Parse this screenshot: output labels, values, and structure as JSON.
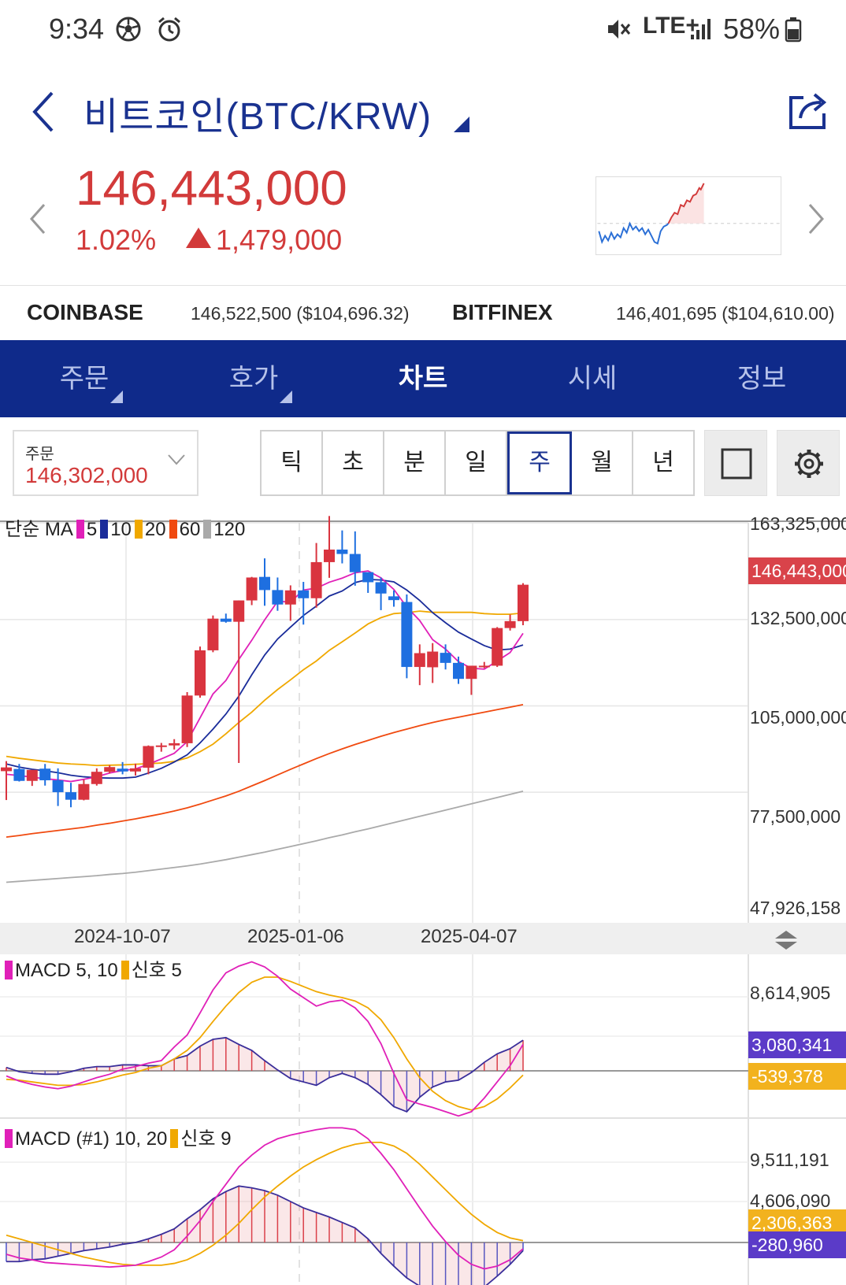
{
  "status_bar": {
    "time": "9:34",
    "network": "LTE+",
    "battery": "58%"
  },
  "header": {
    "title": "비트코인(BTC/KRW)"
  },
  "price": {
    "current": "146,443,000",
    "change_pct": "1.02%",
    "change_amount": "1,479,000"
  },
  "exchanges": [
    {
      "name": "COINBASE",
      "value": "146,522,500 ($104,696.32)"
    },
    {
      "name": "BITFINEX",
      "value": "146,401,695 ($104,610.00)"
    }
  ],
  "tabs": [
    {
      "label": "주문",
      "active": false,
      "has_caret": true
    },
    {
      "label": "호가",
      "active": false,
      "has_caret": true
    },
    {
      "label": "차트",
      "active": true,
      "has_caret": false
    },
    {
      "label": "시세",
      "active": false,
      "has_caret": false
    },
    {
      "label": "정보",
      "active": false,
      "has_caret": false
    }
  ],
  "order": {
    "label": "주문",
    "value": "146,302,000"
  },
  "periods": [
    {
      "label": "틱",
      "active": false
    },
    {
      "label": "초",
      "active": false
    },
    {
      "label": "분",
      "active": false
    },
    {
      "label": "일",
      "active": false
    },
    {
      "label": "주",
      "active": true
    },
    {
      "label": "월",
      "active": false
    },
    {
      "label": "년",
      "active": false
    }
  ],
  "colors": {
    "up": "#d9343f",
    "down": "#1e6fe0",
    "ma5": "#e020b8",
    "ma10": "#1a2c9a",
    "ma20": "#f0a800",
    "ma60": "#f04a10",
    "ma120": "#aaaaaa",
    "nav": "#0f2a8a"
  },
  "chart_data": [
    {
      "type": "candlestick",
      "legend": {
        "title": "단순 MA",
        "periods": [
          "5",
          "10",
          "20",
          "60",
          "120"
        ]
      },
      "y_ticks": [
        "163,325,000",
        "132,500,000",
        "105,000,000",
        "77,500,000",
        "47,926,158"
      ],
      "current_label": "146,443,000",
      "x_ticks": [
        "2024-10-07",
        "2025-01-06",
        "2025-04-07"
      ],
      "ylim": [
        47926158,
        163325000
      ],
      "candles": [
        [
          84.2,
          87.4,
          75.0,
          85.4
        ],
        [
          84.9,
          86.5,
          80.9,
          81.1
        ],
        [
          81.1,
          84.6,
          79.5,
          84.6
        ],
        [
          85.0,
          86.5,
          79.6,
          81.3
        ],
        [
          81.3,
          85.1,
          73.1,
          77.5
        ],
        [
          77.5,
          80.5,
          72.7,
          75.1
        ],
        [
          75.1,
          81.5,
          74.9,
          80.1
        ],
        [
          80.1,
          85.1,
          79.6,
          84.0
        ],
        [
          84.0,
          86.1,
          83.5,
          85.5
        ],
        [
          85.0,
          87.1,
          83.2,
          84.1
        ],
        [
          84.1,
          86.6,
          82.8,
          85.1
        ],
        [
          85.3,
          92.4,
          83.2,
          92.2
        ],
        [
          92.2,
          93.2,
          90.4,
          92.4
        ],
        [
          92.4,
          94.4,
          91.1,
          93.1
        ],
        [
          93.1,
          109.4,
          91.9,
          108.3
        ],
        [
          108.3,
          123.9,
          107.6,
          122.7
        ],
        [
          122.7,
          133.8,
          122.1,
          132.8
        ],
        [
          132.8,
          134.4,
          131.5,
          131.8
        ],
        [
          131.8,
          138.6,
          86.8,
          138.6
        ],
        [
          138.6,
          146.1,
          137.1,
          145.9
        ],
        [
          146.1,
          152.0,
          136.9,
          141.9
        ],
        [
          141.9,
          145.9,
          135.3,
          137.3
        ],
        [
          137.3,
          143.4,
          132.1,
          141.8
        ],
        [
          141.8,
          144.5,
          130.9,
          139.3
        ],
        [
          139.3,
          156.9,
          136.3,
          150.8
        ],
        [
          150.8,
          165.5,
          145.8,
          154.8
        ],
        [
          154.8,
          160.9,
          150.4,
          153.4
        ],
        [
          153.4,
          160.6,
          143.3,
          147.6
        ],
        [
          147.6,
          146.9,
          141.0,
          144.4
        ],
        [
          144.4,
          145.9,
          135.5,
          140.8
        ],
        [
          139.9,
          141.8,
          136.6,
          138.7
        ],
        [
          138.1,
          140.5,
          113.8,
          117.4
        ],
        [
          117.4,
          124.6,
          111.6,
          121.8
        ],
        [
          117.3,
          125.0,
          112.3,
          122.3
        ],
        [
          121.9,
          124.6,
          116.6,
          118.7
        ],
        [
          118.7,
          120.7,
          112.0,
          113.6
        ],
        [
          113.6,
          117.8,
          108.5,
          117.8
        ],
        [
          117.8,
          119.0,
          117.0,
          117.8
        ],
        [
          117.8,
          130.1,
          117.4,
          129.8
        ],
        [
          129.8,
          134.1,
          129.0,
          132.0
        ],
        [
          132.0,
          144.1,
          130.7,
          143.6
        ]
      ],
      "ma5": [
        83.2,
        82.8,
        82.3,
        81.8,
        81.4,
        80.9,
        81.6,
        82.4,
        83.6,
        84.4,
        84.9,
        86.4,
        88.1,
        89.9,
        93.6,
        101.2,
        108.8,
        113.1,
        119.8,
        125.9,
        132.4,
        138.3,
        138.1,
        141.9,
        142.5,
        144.4,
        145.7,
        147.4,
        148.0,
        145.8,
        142.1,
        136.5,
        132.2,
        126.1,
        123.1,
        119.1,
        117.0,
        116.7,
        119.3,
        122.0,
        128.1
      ],
      "ma10": [
        86.5,
        85.5,
        84.8,
        84.3,
        83.7,
        82.9,
        82.4,
        82.1,
        82.0,
        82.0,
        82.3,
        83.6,
        85.1,
        87.1,
        89.4,
        93.2,
        97.6,
        102.4,
        108.1,
        114.9,
        121.2,
        126.3,
        130.1,
        133.8,
        136.8,
        140.0,
        141.6,
        144.3,
        145.3,
        145.1,
        144.5,
        141.9,
        138.6,
        134.7,
        131.5,
        128.5,
        126.3,
        124.2,
        122.8,
        123.1,
        124.4
      ],
      "ma20": [
        88.9,
        88.3,
        87.8,
        87.3,
        86.8,
        86.5,
        86.3,
        86.0,
        86.1,
        86.2,
        86.4,
        86.6,
        86.8,
        87.3,
        88.4,
        90.4,
        92.8,
        96.1,
        99.7,
        103.0,
        106.8,
        110.2,
        113.3,
        116.5,
        119.3,
        122.7,
        125.4,
        128.2,
        131.1,
        133.1,
        134.4,
        134.7,
        135.2,
        134.8,
        134.8,
        134.8,
        134.8,
        134.4,
        134.2,
        134.2,
        134.6
      ],
      "ma60": [
        63.2,
        63.7,
        64.3,
        64.8,
        65.3,
        65.8,
        66.3,
        67.0,
        67.6,
        68.3,
        69.0,
        69.8,
        70.6,
        71.5,
        72.5,
        73.7,
        75.0,
        76.3,
        77.8,
        79.5,
        81.2,
        83.0,
        84.8,
        86.5,
        88.2,
        89.8,
        91.3,
        92.7,
        94.0,
        95.3,
        96.5,
        97.6,
        98.7,
        99.7,
        100.6,
        101.4,
        102.2,
        103.0,
        103.8,
        104.6,
        105.4
      ],
      "ma120": [
        48.8,
        49.1,
        49.4,
        49.7,
        50.0,
        50.3,
        50.6,
        50.9,
        51.3,
        51.6,
        52.0,
        52.5,
        53.0,
        53.5,
        54.0,
        54.6,
        55.3,
        56.0,
        56.8,
        57.6,
        58.4,
        59.3,
        60.2,
        61.1,
        62.0,
        63.0,
        63.9,
        64.9,
        65.8,
        66.8,
        67.8,
        68.8,
        69.8,
        70.8,
        71.8,
        72.8,
        73.8,
        74.8,
        75.8,
        76.8,
        77.8
      ],
      "units": "millions KRW"
    },
    {
      "type": "macd",
      "legend": {
        "title": "MACD 5, 10",
        "signal": "신호 5"
      },
      "y_ticks": [
        "8,614,905"
      ],
      "badges": [
        "3,080,341",
        "-539,378"
      ],
      "ylim": [
        -10500000,
        13500000
      ],
      "macd": [
        -0.6,
        -1.2,
        -1.6,
        -1.9,
        -2.1,
        -1.8,
        -1.3,
        -0.8,
        -0.4,
        0.2,
        0.5,
        0.9,
        1.2,
        2.8,
        4.2,
        6.8,
        9.5,
        11.5,
        12.3,
        12.8,
        12.2,
        11.1,
        9.6,
        8.6,
        7.6,
        8.1,
        8.3,
        7.4,
        5.8,
        3.2,
        -0.3,
        -3.4,
        -3.9,
        -4.3,
        -4.8,
        -5.3,
        -4.8,
        -3.2,
        -1.3,
        0.6,
        3.1
      ],
      "signal": [
        -1.0,
        -1.1,
        -1.3,
        -1.5,
        -1.7,
        -1.7,
        -1.6,
        -1.3,
        -0.9,
        -0.5,
        -0.2,
        0.3,
        0.6,
        1.4,
        2.4,
        3.9,
        5.8,
        7.6,
        9.2,
        10.4,
        11.0,
        11.0,
        10.5,
        9.9,
        9.3,
        8.9,
        8.6,
        8.2,
        7.4,
        6.0,
        3.9,
        1.4,
        -0.8,
        -2.4,
        -3.5,
        -4.2,
        -4.6,
        -4.2,
        -3.3,
        -2.0,
        -0.5
      ]
    },
    {
      "type": "macd",
      "legend": {
        "title": "MACD (#1) 10, 20",
        "signal": "신호 9"
      },
      "y_ticks": [
        "9,511,191",
        "4,606,090"
      ],
      "badges": [
        "2,306,363",
        "-280,960"
      ],
      "ylim": [
        -10500000,
        13500000
      ],
      "macd": [
        -1.3,
        -1.7,
        -1.9,
        -2.2,
        -2.3,
        -2.4,
        -2.5,
        -2.6,
        -2.7,
        -2.6,
        -2.5,
        -2.1,
        -1.6,
        -0.8,
        0.7,
        2.4,
        4.5,
        6.4,
        8.3,
        9.6,
        10.7,
        11.4,
        11.8,
        12.1,
        12.4,
        12.6,
        12.6,
        12.4,
        11.4,
        9.8,
        8.0,
        5.9,
        3.8,
        1.8,
        0.1,
        -1.4,
        -2.4,
        -2.9,
        -2.6,
        -1.9,
        -0.7
      ],
      "signal": [
        0.8,
        0.4,
        0.0,
        -0.4,
        -0.8,
        -1.2,
        -1.6,
        -1.9,
        -2.2,
        -2.4,
        -2.5,
        -2.5,
        -2.5,
        -2.3,
        -1.9,
        -1.2,
        -0.3,
        0.8,
        2.1,
        3.6,
        5.0,
        6.2,
        7.3,
        8.3,
        9.1,
        9.8,
        10.4,
        10.8,
        11.0,
        11.0,
        10.6,
        9.8,
        8.6,
        7.2,
        5.8,
        4.4,
        3.1,
        2.0,
        1.1,
        0.5,
        0.2
      ]
    }
  ]
}
